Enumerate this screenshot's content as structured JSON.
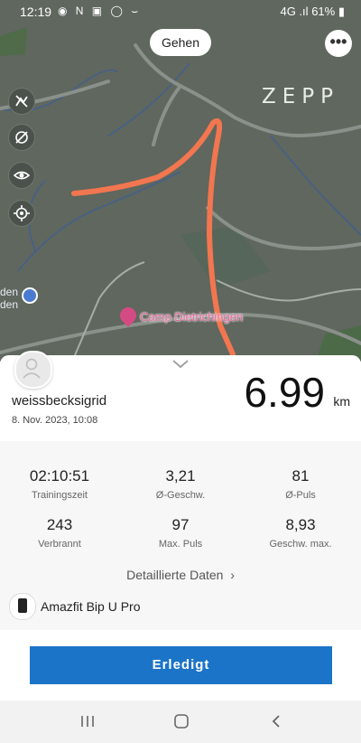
{
  "status_bar": {
    "time": "12:19",
    "notification_icons": "◉ N ▣ ◯ ⌣",
    "signal": "4G .ıl",
    "battery": "61%"
  },
  "map": {
    "activity_type_label": "Gehen",
    "more_label": "•••",
    "brand": "ZEPP",
    "poi_label": "Camp Dietrichingen",
    "poi_partial_label_1": "den",
    "poi_partial_label_2": "den",
    "route_color": "#f2764f",
    "controls": [
      "satellite-off-icon",
      "layer-off-icon",
      "eye-icon",
      "locate-icon"
    ]
  },
  "summary": {
    "username": "weissbecksigrid",
    "date": "8. Nov. 2023, 10:08",
    "distance": "6.99",
    "distance_unit": "km"
  },
  "stats": [
    {
      "value": "02:10:51",
      "label": "Trainingszeit"
    },
    {
      "value": "3,21",
      "label": "Ø-Geschw."
    },
    {
      "value": "81",
      "label": "Ø-Puls"
    },
    {
      "value": "243",
      "label": "Verbrannt"
    },
    {
      "value": "97",
      "label": "Max. Puls"
    },
    {
      "value": "8,93",
      "label": "Geschw. max."
    }
  ],
  "details_link": "Detaillierte Daten",
  "device_name": "Amazfit Bip U Pro",
  "done_button": "Erledigt",
  "accent_color": "#1b74c8"
}
